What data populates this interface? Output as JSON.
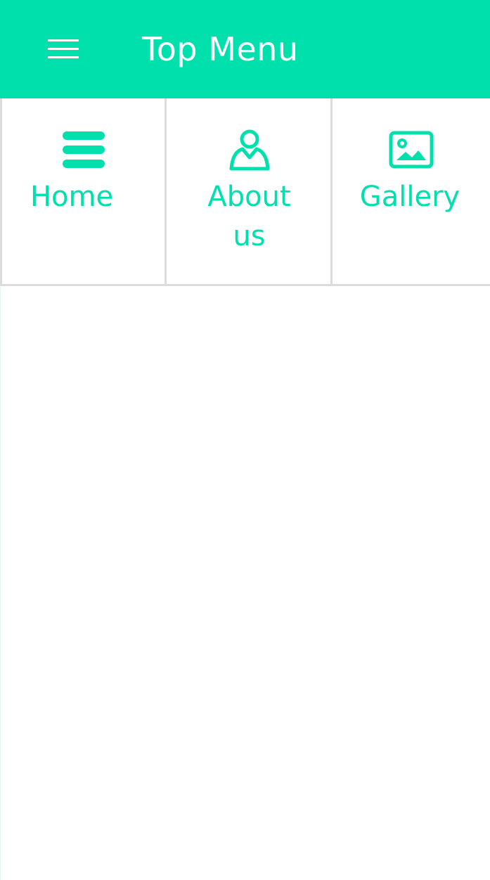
{
  "header": {
    "title": "Top Menu",
    "menu_icon": "hamburger-menu-icon",
    "background_color": "#00e0ad"
  },
  "nav": {
    "accent_color": "#00e0ad",
    "items": [
      {
        "label": "Home",
        "icon": "bars-icon"
      },
      {
        "label": "About us",
        "icon": "user-icon"
      },
      {
        "label": "Gallery",
        "icon": "image-icon"
      }
    ]
  }
}
